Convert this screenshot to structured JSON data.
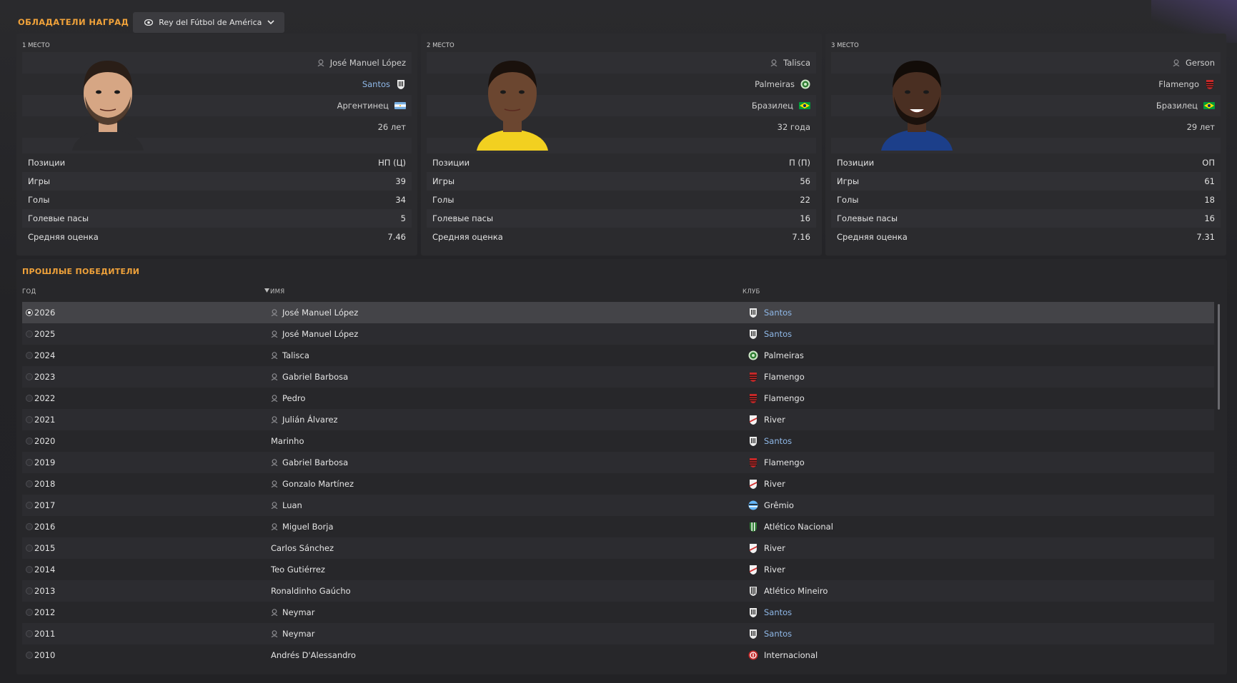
{
  "header": {
    "title": "ОБЛАДАТЕЛИ НАГРАД",
    "award_selected": "Rey del Fútbol de América"
  },
  "podium": [
    {
      "place": "1 МЕСТО",
      "name": "José Manuel López",
      "club": "Santos",
      "club_is_link": true,
      "nationality": "Аргентинец",
      "age": "26 лет",
      "stats": [
        {
          "label": "Позиции",
          "value": "НП (Ц)"
        },
        {
          "label": "Игры",
          "value": "39"
        },
        {
          "label": "Голы",
          "value": "34"
        },
        {
          "label": "Голевые пасы",
          "value": "5"
        },
        {
          "label": "Средняя оценка",
          "value": "7.46"
        }
      ]
    },
    {
      "place": "2 МЕСТО",
      "name": "Talisca",
      "club": "Palmeiras",
      "club_is_link": false,
      "nationality": "Бразилец",
      "age": "32 года",
      "stats": [
        {
          "label": "Позиции",
          "value": "П (П)"
        },
        {
          "label": "Игры",
          "value": "56"
        },
        {
          "label": "Голы",
          "value": "22"
        },
        {
          "label": "Голевые пасы",
          "value": "16"
        },
        {
          "label": "Средняя оценка",
          "value": "7.16"
        }
      ]
    },
    {
      "place": "3 МЕСТО",
      "name": "Gerson",
      "club": "Flamengo",
      "club_is_link": false,
      "nationality": "Бразилец",
      "age": "29 лет",
      "stats": [
        {
          "label": "Позиции",
          "value": "ОП"
        },
        {
          "label": "Игры",
          "value": "61"
        },
        {
          "label": "Голы",
          "value": "18"
        },
        {
          "label": "Голевые пасы",
          "value": "16"
        },
        {
          "label": "Средняя оценка",
          "value": "7.31"
        }
      ]
    }
  ],
  "past_winners": {
    "title": "ПРОШЛЫЕ ПОБЕДИТЕЛИ",
    "columns": {
      "year": "ГОД",
      "name": "ИМЯ",
      "club": "КЛУБ"
    },
    "rows": [
      {
        "year": "2026",
        "name": "José Manuel López",
        "person_icon": true,
        "club": "Santos",
        "club_is_link": true,
        "crest": "santos-crest-icon",
        "selected": true
      },
      {
        "year": "2025",
        "name": "José Manuel López",
        "person_icon": true,
        "club": "Santos",
        "club_is_link": true,
        "crest": "santos-crest-icon"
      },
      {
        "year": "2024",
        "name": "Talisca",
        "person_icon": true,
        "club": "Palmeiras",
        "club_is_link": false,
        "crest": "palmeiras-crest-icon"
      },
      {
        "year": "2023",
        "name": "Gabriel Barbosa",
        "person_icon": true,
        "club": "Flamengo",
        "club_is_link": false,
        "crest": "flamengo-crest-icon"
      },
      {
        "year": "2022",
        "name": "Pedro",
        "person_icon": true,
        "club": "Flamengo",
        "club_is_link": false,
        "crest": "flamengo-crest-icon"
      },
      {
        "year": "2021",
        "name": "Julián Álvarez",
        "person_icon": true,
        "club": "River",
        "club_is_link": false,
        "crest": "river-crest-icon"
      },
      {
        "year": "2020",
        "name": "Marinho",
        "person_icon": false,
        "club": "Santos",
        "club_is_link": true,
        "crest": "santos-crest-icon"
      },
      {
        "year": "2019",
        "name": "Gabriel Barbosa",
        "person_icon": true,
        "club": "Flamengo",
        "club_is_link": false,
        "crest": "flamengo-crest-icon"
      },
      {
        "year": "2018",
        "name": "Gonzalo Martínez",
        "person_icon": true,
        "club": "River",
        "club_is_link": false,
        "crest": "river-crest-icon"
      },
      {
        "year": "2017",
        "name": "Luan",
        "person_icon": true,
        "club": "Grêmio",
        "club_is_link": false,
        "crest": "gremio-crest-icon"
      },
      {
        "year": "2016",
        "name": "Miguel Borja",
        "person_icon": true,
        "club": "Atlético Nacional",
        "club_is_link": false,
        "crest": "nacional-crest-icon"
      },
      {
        "year": "2015",
        "name": "Carlos Sánchez",
        "person_icon": false,
        "club": "River",
        "club_is_link": false,
        "crest": "river-crest-icon"
      },
      {
        "year": "2014",
        "name": "Teo Gutiérrez",
        "person_icon": false,
        "club": "River",
        "club_is_link": false,
        "crest": "river-crest-icon"
      },
      {
        "year": "2013",
        "name": "Ronaldinho Gaúcho",
        "person_icon": false,
        "club": "Atlético Mineiro",
        "club_is_link": false,
        "crest": "mineiro-crest-icon"
      },
      {
        "year": "2012",
        "name": "Neymar",
        "person_icon": true,
        "club": "Santos",
        "club_is_link": true,
        "crest": "santos-crest-icon"
      },
      {
        "year": "2011",
        "name": "Neymar",
        "person_icon": true,
        "club": "Santos",
        "club_is_link": true,
        "crest": "santos-crest-icon"
      },
      {
        "year": "2010",
        "name": "Andrés D'Alessandro",
        "person_icon": false,
        "club": "Internacional",
        "club_is_link": false,
        "crest": "internacional-crest-icon"
      }
    ]
  },
  "colors": {
    "accent": "#f0a23a",
    "link": "#8fb8e8",
    "panel": "#2b2b2e",
    "background": "#222225"
  }
}
